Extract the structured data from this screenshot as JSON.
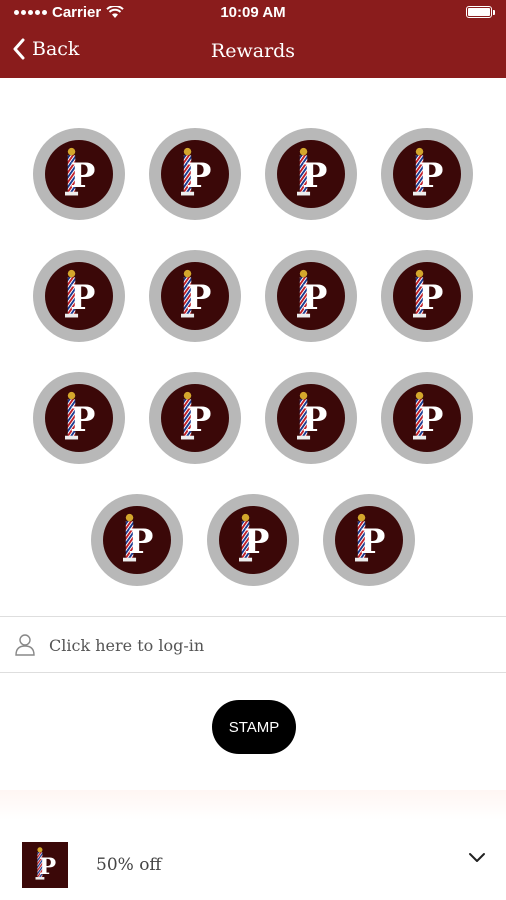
{
  "status_bar": {
    "carrier": "Carrier",
    "time": "10:09 AM"
  },
  "nav": {
    "back_label": "Back",
    "title": "Rewards"
  },
  "stamps": {
    "count": 15,
    "logo_letter": "P"
  },
  "login": {
    "label": "Click here to log-in"
  },
  "stamp_button": {
    "label": "STAMP"
  },
  "reward": {
    "label": "50% off",
    "logo_letter": "P"
  },
  "colors": {
    "header": "#8a1c1c",
    "stamp_ring": "#b8b8b8",
    "stamp_fill": "#3b0808"
  }
}
